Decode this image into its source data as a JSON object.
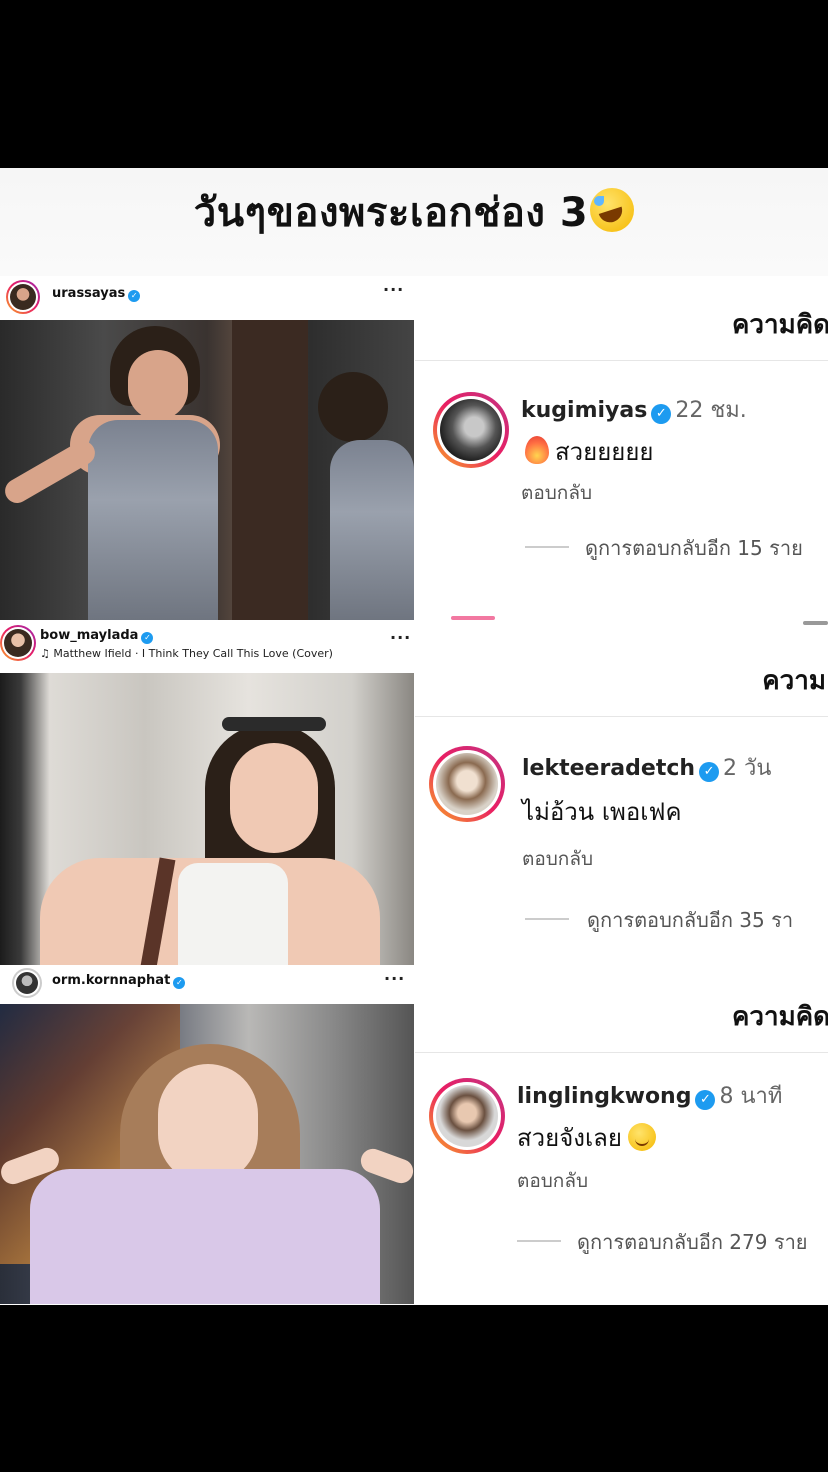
{
  "title": "วันๆของพระเอกช่อง 3",
  "title_emoji": "rolling-on-floor-laughing-emoji",
  "posts": [
    {
      "username": "urassayas",
      "more": "···"
    },
    {
      "username": "bow_maylada",
      "music": "Matthew Ifield · I Think They Call This Love (Cover)",
      "more": "···"
    },
    {
      "username": "orm.kornnaphat",
      "more": "···"
    }
  ],
  "comments": [
    {
      "header": "ความคิด",
      "user": "kugimiyas",
      "time": "22 ชม.",
      "text": "สวยยยยย",
      "reply": "ตอบกลับ",
      "view_more": "ดูการตอบกลับอีก 15 ราย"
    },
    {
      "header": "ความ",
      "user": "lekteeradetch",
      "time": "2 วัน",
      "text": "ไม่อ้วน เพอเฟค",
      "reply": "ตอบกลับ",
      "view_more": "ดูการตอบกลับอีก 35 รา"
    },
    {
      "header": "ความคิด",
      "user": "linglingkwong",
      "time": "8 นาที",
      "text": "สวยจังเลย",
      "reply": "ตอบกลับ",
      "view_more": "ดูการตอบกลับอีก 279 ราย"
    }
  ],
  "colors": {
    "verified": "#1d9bf0",
    "story_ring_start": "#f9a825",
    "story_ring_end": "#c13584",
    "background": "#000000"
  }
}
